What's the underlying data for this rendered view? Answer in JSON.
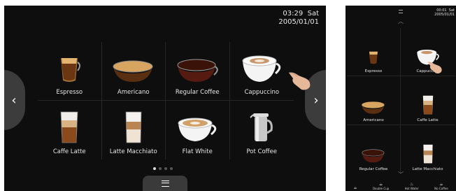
{
  "landscape": {
    "clock": {
      "time": "03:29",
      "day": "Sat",
      "date": "2005/01/01"
    },
    "drinks": [
      {
        "label": "Espresso",
        "icon": "espresso-cup-icon"
      },
      {
        "label": "Americano",
        "icon": "americano-cup-icon"
      },
      {
        "label": "Regular Coffee",
        "icon": "regular-coffee-cup-icon"
      },
      {
        "label": "Cappuccino",
        "icon": "cappuccino-cup-icon"
      },
      {
        "label": "Caffe Latte",
        "icon": "caffe-latte-glass-icon"
      },
      {
        "label": "Latte Macchiato",
        "icon": "latte-macchiato-glass-icon"
      },
      {
        "label": "Flat White",
        "icon": "flat-white-cup-icon"
      },
      {
        "label": "Pot Coffee",
        "icon": "coffee-pot-icon"
      }
    ],
    "prev_arrow": "‹",
    "next_arrow": "›",
    "page_dots": {
      "count": 4,
      "active": 1
    }
  },
  "portrait": {
    "clock": {
      "time": "00:01",
      "day": "Sat",
      "date": "2005/01/01"
    },
    "drinks": [
      {
        "label": "Espresso",
        "icon": "espresso-cup-icon"
      },
      {
        "label": "Cappuccino",
        "icon": "cappuccino-cup-icon"
      },
      {
        "label": "Americano",
        "icon": "americano-cup-icon"
      },
      {
        "label": "Caffe Latte",
        "icon": "caffe-latte-glass-icon"
      },
      {
        "label": "Regular Coffee",
        "icon": "regular-coffee-cup-icon"
      },
      {
        "label": "Latte Macchiato",
        "icon": "latte-macchiato-glass-icon"
      }
    ],
    "bottom_items": [
      {
        "label": "",
        "icon": "cup-icon"
      },
      {
        "label": "Double Cup",
        "icon": "double-cup-icon"
      },
      {
        "label": "Hot Water",
        "icon": "hot-water-icon"
      },
      {
        "label": "No Coffee",
        "icon": "no-coffee-icon"
      }
    ]
  }
}
